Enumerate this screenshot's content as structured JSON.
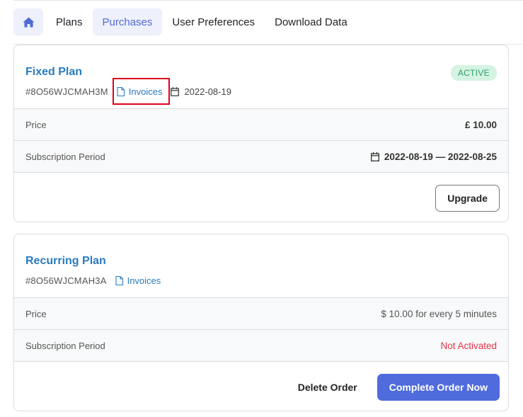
{
  "nav": {
    "home_icon": "home-icon",
    "tabs": [
      {
        "label": "Plans"
      },
      {
        "label": "Purchases"
      },
      {
        "label": "User Preferences"
      },
      {
        "label": "Download Data"
      }
    ],
    "active_tab": "Purchases"
  },
  "colors": {
    "accent": "#4f6bdc",
    "link": "#2a7bbd",
    "active_badge_bg": "#d5f3e3",
    "active_badge_text": "#2e9e68",
    "not_activated": "#e8334a",
    "highlight": "#e0001b"
  },
  "orders": [
    {
      "title": "Fixed Plan",
      "order_id": "#8O56WJCMAH3M",
      "invoices_label": "Invoices",
      "date": "2022-08-19",
      "status_badge": "ACTIVE",
      "price_label": "Price",
      "price_value": "£ 10.00",
      "period_label": "Subscription Period",
      "period_value": "2022-08-19 — 2022-08-25",
      "upgrade_label": "Upgrade"
    },
    {
      "title": "Recurring Plan",
      "order_id": "#8O56WJCMAH3A",
      "invoices_label": "Invoices",
      "price_label": "Price",
      "price_value": "$ 10.00 for every 5 minutes",
      "period_label": "Subscription Period",
      "period_value": "Not Activated",
      "delete_label": "Delete Order",
      "complete_label": "Complete Order Now"
    }
  ]
}
